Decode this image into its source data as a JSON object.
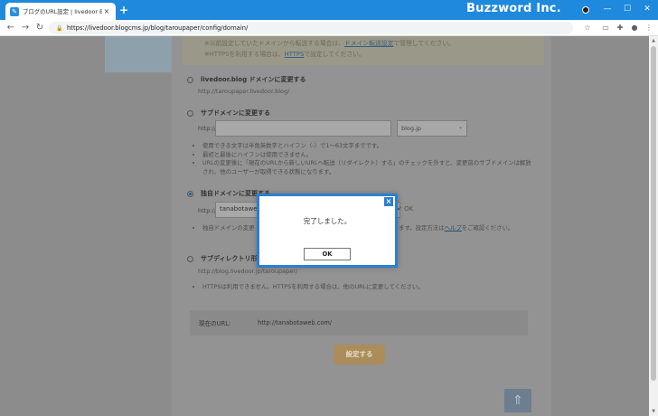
{
  "browser": {
    "tab_title": "ブログのURL設定 | livedoor Blog",
    "brand": "Buzzword Inc.",
    "url": "https://livedoor.blogcms.jp/blog/taroupaper/config/domain/"
  },
  "notice": {
    "line1_prefix": "※以前設定していたドメインから転送する場合は、",
    "line1_link": "ドメイン転送設定",
    "line1_suffix": "で管理してください。",
    "line2_prefix": "※HTTPSを利用する場合は、",
    "line2_link": "HTTPS",
    "line2_suffix": "で設定してください。"
  },
  "options": {
    "livedoor": {
      "label": "livedoor.blog ドメインに変更する",
      "sub": "http://taroupaper.livedoor.blog/"
    },
    "subdomain": {
      "label": "サブドメインに変更する",
      "prefix": "http://",
      "select_value": "blog.jp",
      "bullets": [
        "使用できる文字は半角英数字とハイフン（-）で1～63文字までです。",
        "最初と最後にハイフンは使用できません。",
        "URLの変更後に「現在のURLから新しいURLへ転送（リダイレクト）する」のチェックを外すと、変更前のサブドメインは解放され、他のユーザーが取得できる状態になります。"
      ]
    },
    "custom": {
      "label": "独自ドメインに変更する",
      "prefix": "http://",
      "input_value": "tanabotaweb.com",
      "ok_label": "OK",
      "bullet_prefix": "独自ドメインの変更",
      "bullet_suffix": "要になります。設定方法は",
      "bullet_link": "ヘルプ",
      "bullet_end": "をご確認ください。"
    },
    "subdir": {
      "label": "サブディレクトリ形",
      "sub": "http://blog.livedoor.jp/taroupaper/",
      "bullet": "HTTPSは利用できません。HTTPSを利用する場合は、他のURLに変更してください。"
    }
  },
  "current_url": {
    "label": "現在のURL:",
    "value": "http://tanabotaweb.com/"
  },
  "save_button": "設定する",
  "dialog": {
    "message": "完了しました。",
    "ok": "OK"
  }
}
